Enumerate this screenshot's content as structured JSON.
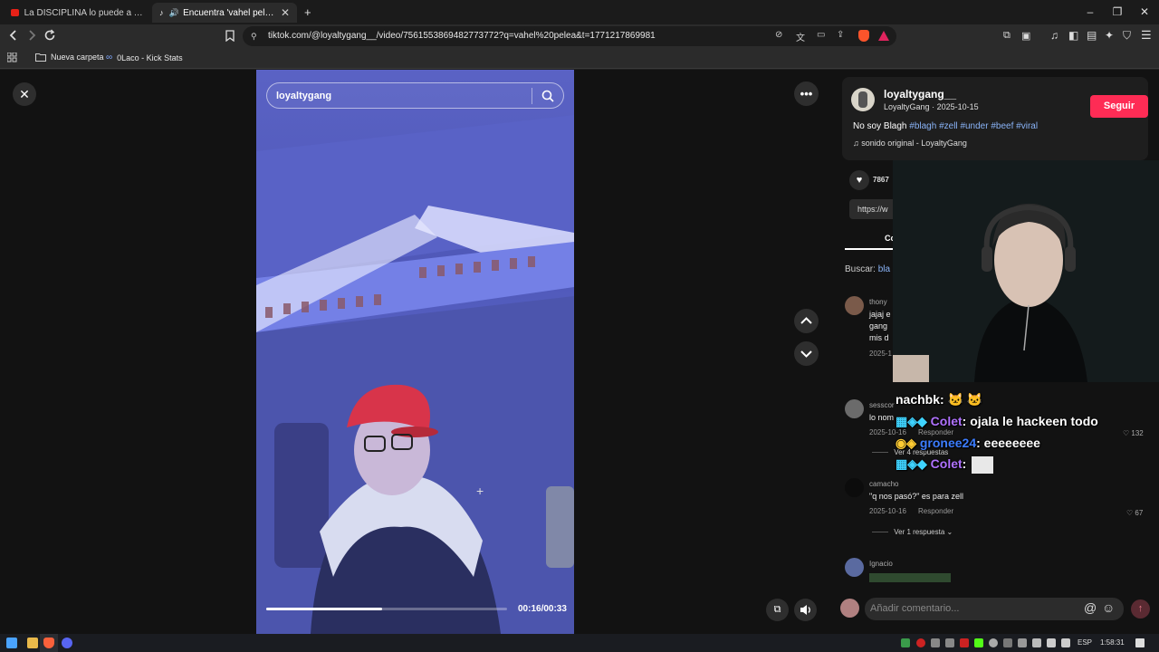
{
  "tabs": [
    {
      "title": "La DISCIPLINA lo puede a TODO - El",
      "active": false
    },
    {
      "title": "Encuentra 'vahel pelea' en Tik",
      "active": true
    }
  ],
  "new_tab_symbol": "+",
  "address": {
    "url": "tiktok.com/@loyaltygang__/video/7561553869482773772?q=vahel%20pelea&t=1771217869981"
  },
  "bookmarks": [
    {
      "label": "Nueva carpeta",
      "icon": "folder-icon"
    },
    {
      "label": "0Laco - Kick Stats",
      "icon": "kick-icon"
    }
  ],
  "video": {
    "search_value": "loyaltygang",
    "time": "00:16/00:33",
    "progress": 0.48
  },
  "post": {
    "username": "loyaltygang__",
    "display_name": "LoyaltyGang",
    "date": "2025-10-15",
    "follow_label": "Seguir",
    "caption_text": "No soy Blagh",
    "hashtags": [
      "#blagh",
      "#zell",
      "#under",
      "#beef",
      "#viral"
    ],
    "music": "sonido original - LoyaltyGang",
    "likes": "7867",
    "link_preview": "https://w",
    "tab_label": "Co",
    "search_label": "Buscar:",
    "search_value": "bla"
  },
  "comments": [
    {
      "user": "thony",
      "lines": [
        "jajaj e",
        "gang",
        "mis d"
      ],
      "date": "2025-1"
    },
    {
      "user": "sesscor",
      "text": "lo nom",
      "date": "2025-10-16",
      "reply": "Responder",
      "likes": "132",
      "more": "Ver 4 respuestas"
    },
    {
      "user": "camacho",
      "text": "\"q nos pasó?\" es para zell",
      "date": "2025-10-16",
      "reply": "Responder",
      "likes": "67",
      "more": "Ver 1 respuesta"
    },
    {
      "user": "Ignacio"
    }
  ],
  "comment_input": {
    "placeholder": "Añadir comentario..."
  },
  "chat_overlay": [
    {
      "user": "nachbk",
      "message": ": ",
      "color": "#ffffff"
    },
    {
      "user": "Colet",
      "message": ": ojala le hackeen todo",
      "color": "#b072ff"
    },
    {
      "user": "gronee24",
      "message": ": eeeeeeee",
      "color": "#3c7dff"
    },
    {
      "user": "Colet",
      "message": ": ",
      "color": "#b072ff"
    }
  ],
  "taskbar": {
    "lang": "ESP",
    "time": "1:58:31"
  },
  "colors": {
    "accent": "#fe2c55",
    "hashtag": "#8ab4f8",
    "video_tint": "#5a62c4"
  }
}
